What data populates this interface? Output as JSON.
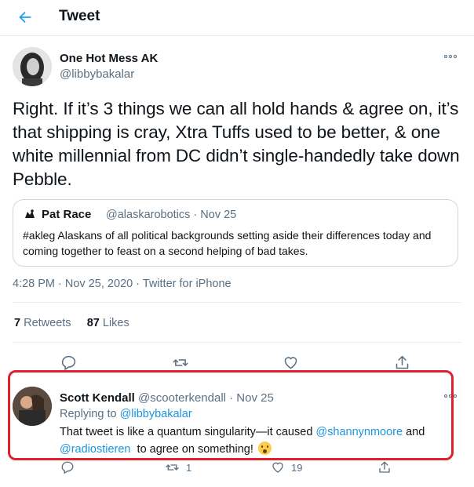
{
  "header": {
    "title": "Tweet",
    "back_icon": "arrow-left-icon"
  },
  "main_tweet": {
    "display_name": "One Hot Mess AK",
    "handle": "@libbybakalar",
    "text": "Right. If it’s 3 things we can all hold hands & agree on, it’s that shipping is cray, Xtra Tuffs used to be better, & one white millennial from DC didn’t single-handedly take down Pebble.",
    "timestamp": "4:28 PM · Nov 25, 2020 · Twitter for iPhone",
    "retweets_count": "7",
    "retweets_label": "Retweets",
    "likes_count": "87",
    "likes_label": "Likes"
  },
  "quoted_tweet": {
    "display_name": "Pat Race",
    "meta": "@alaskarobotics · Nov 25",
    "text": "#akleg Alaskans of all political backgrounds setting aside their differences today and coming together to feast on a second helping of bad takes."
  },
  "reply": {
    "display_name": "Scott Kendall",
    "handle_date": "@scooterkendall · Nov 25",
    "replying_prefix": "Replying to",
    "replying_to": "@libbybakalar",
    "text_before": "That tweet is like a quantum singularity—it caused",
    "mention_1": "@shannynmoore",
    "text_middle": "and",
    "mention_2": "@radiostieren",
    "text_after": "to agree on something!",
    "retweet_count": "1",
    "like_count": "19"
  },
  "colors": {
    "accent": "#1b95e0",
    "muted": "#5b7083",
    "highlight_border": "#e0202c"
  }
}
